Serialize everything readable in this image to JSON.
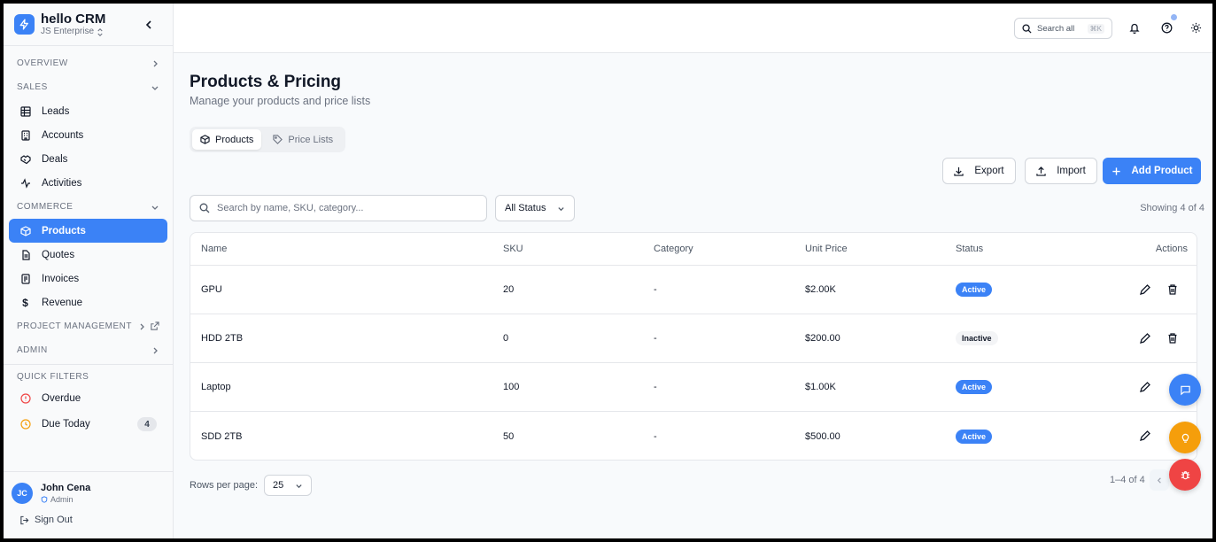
{
  "brand": {
    "title": "hello CRM",
    "org": "JS Enterprise"
  },
  "sidebar": {
    "sections": {
      "overview": "OVERVIEW",
      "sales": "SALES",
      "commerce": "COMMERCE",
      "project_management": "PROJECT MANAGEMENT",
      "admin": "ADMIN",
      "quick_filters": "QUICK FILTERS"
    },
    "sales_items": [
      {
        "label": "Leads",
        "icon": "table-icon"
      },
      {
        "label": "Accounts",
        "icon": "building-icon"
      },
      {
        "label": "Deals",
        "icon": "handshake-icon"
      },
      {
        "label": "Activities",
        "icon": "activity-icon"
      }
    ],
    "commerce_items": [
      {
        "label": "Products",
        "icon": "package-icon",
        "active": true
      },
      {
        "label": "Quotes",
        "icon": "file-icon"
      },
      {
        "label": "Invoices",
        "icon": "receipt-icon"
      },
      {
        "label": "Revenue",
        "icon": "dollar-icon"
      }
    ],
    "quick_filters": [
      {
        "label": "Overdue",
        "icon": "alert-circle-icon",
        "color": "#ef4444"
      },
      {
        "label": "Due Today",
        "icon": "clock-icon",
        "color": "#f59e0b",
        "count": "4"
      }
    ]
  },
  "user": {
    "initials": "JC",
    "name": "John Cena",
    "role": "Admin",
    "sign_out": "Sign Out"
  },
  "header": {
    "search_label": "Search all",
    "shortcut": "⌘K"
  },
  "page": {
    "title": "Products & Pricing",
    "subtitle": "Manage your products and price lists",
    "tabs": [
      {
        "label": "Products",
        "active": true
      },
      {
        "label": "Price Lists"
      }
    ],
    "export_label": "Export",
    "import_label": "Import",
    "add_label": "Add Product",
    "search_placeholder": "Search by name, SKU, category...",
    "status_filter": "All Status",
    "showing": "Showing 4 of 4"
  },
  "table": {
    "columns": [
      "Name",
      "SKU",
      "Category",
      "Unit Price",
      "Status",
      "Actions"
    ],
    "rows": [
      {
        "name": "GPU",
        "sku": "20",
        "category": "-",
        "price": "$2.00K",
        "status": "Active"
      },
      {
        "name": "HDD 2TB",
        "sku": "0",
        "category": "-",
        "price": "$200.00",
        "status": "Inactive"
      },
      {
        "name": "Laptop",
        "sku": "100",
        "category": "-",
        "price": "$1.00K",
        "status": "Active"
      },
      {
        "name": "SDD 2TB",
        "sku": "50",
        "category": "-",
        "price": "$500.00",
        "status": "Active"
      }
    ]
  },
  "pagination": {
    "rows_per_page_label": "Rows per page:",
    "rows_per_page": "25",
    "range": "1–4 of 4"
  },
  "colors": {
    "accent": "#3b82f6",
    "warning": "#f59e0b",
    "danger": "#ef4444"
  }
}
